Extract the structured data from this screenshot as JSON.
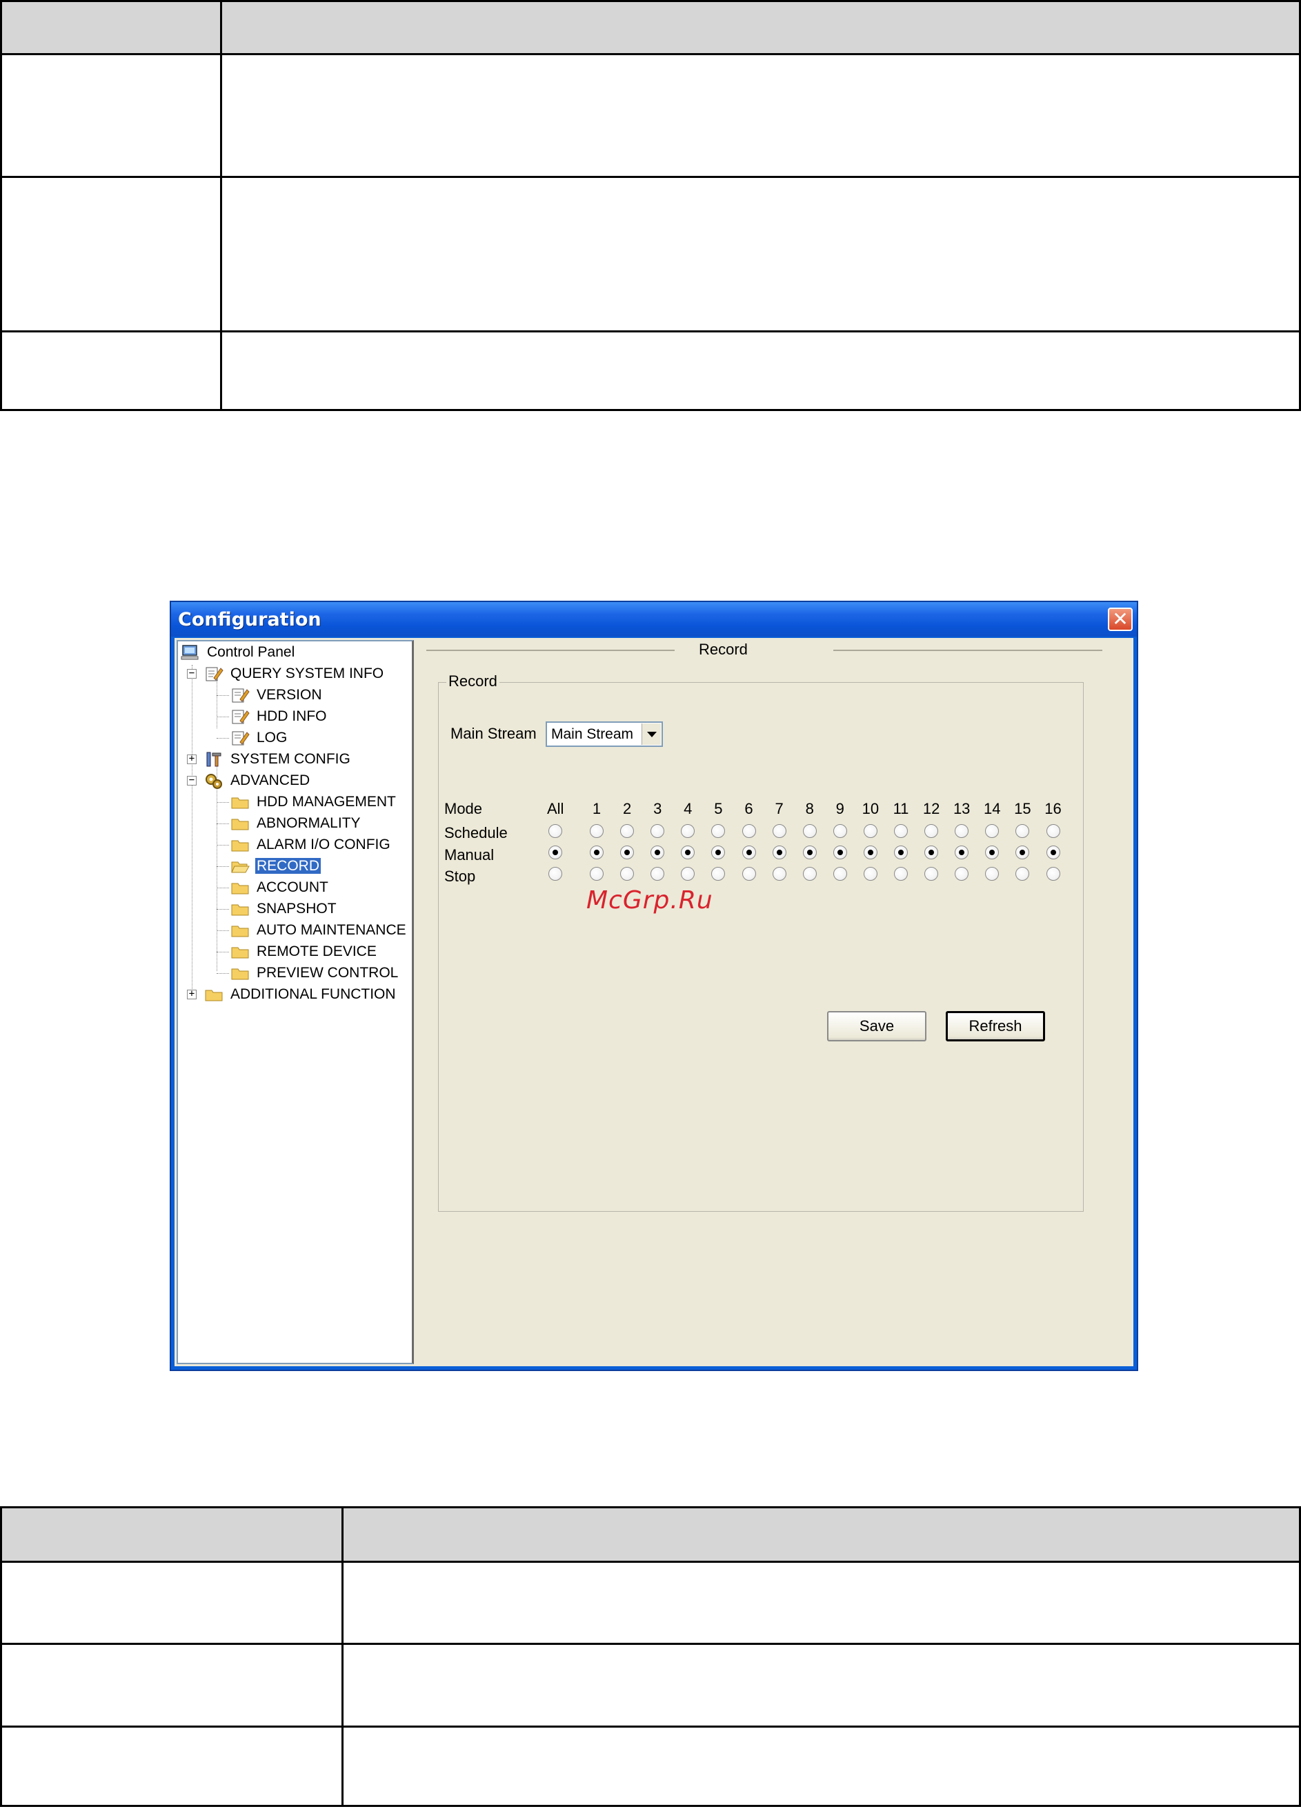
{
  "window": {
    "title": "Configuration",
    "close_label": "✕"
  },
  "tree": {
    "items": [
      {
        "label": "Control Panel"
      },
      {
        "label": "QUERY SYSTEM INFO"
      },
      {
        "label": "VERSION"
      },
      {
        "label": "HDD INFO"
      },
      {
        "label": "LOG"
      },
      {
        "label": "SYSTEM CONFIG"
      },
      {
        "label": "ADVANCED"
      },
      {
        "label": "HDD MANAGEMENT"
      },
      {
        "label": "ABNORMALITY"
      },
      {
        "label": "ALARM I/O CONFIG"
      },
      {
        "label": "RECORD"
      },
      {
        "label": "ACCOUNT"
      },
      {
        "label": "SNAPSHOT"
      },
      {
        "label": "AUTO MAINTENANCE"
      },
      {
        "label": "REMOTE DEVICE"
      },
      {
        "label": "PREVIEW CONTROL"
      },
      {
        "label": "ADDITIONAL FUNCTION"
      }
    ],
    "selected": "RECORD"
  },
  "record_page": {
    "title": "Record",
    "group_label": "Record",
    "stream_label": "Main Stream",
    "stream_value": "Main Stream",
    "mode_header": "Mode",
    "all_header": "All",
    "channels": [
      "1",
      "2",
      "3",
      "4",
      "5",
      "6",
      "7",
      "8",
      "9",
      "10",
      "11",
      "12",
      "13",
      "14",
      "15",
      "16"
    ],
    "modes": [
      {
        "label": "Schedule",
        "all": false,
        "channels": [
          false,
          false,
          false,
          false,
          false,
          false,
          false,
          false,
          false,
          false,
          false,
          false,
          false,
          false,
          false,
          false
        ]
      },
      {
        "label": "Manual",
        "all": true,
        "channels": [
          true,
          true,
          true,
          true,
          true,
          true,
          true,
          true,
          true,
          true,
          true,
          true,
          true,
          true,
          true,
          true
        ]
      },
      {
        "label": "Stop",
        "all": false,
        "channels": [
          false,
          false,
          false,
          false,
          false,
          false,
          false,
          false,
          false,
          false,
          false,
          false,
          false,
          false,
          false,
          false
        ]
      }
    ],
    "save_label": "Save",
    "refresh_label": "Refresh"
  },
  "watermark": "McGrp.Ru"
}
